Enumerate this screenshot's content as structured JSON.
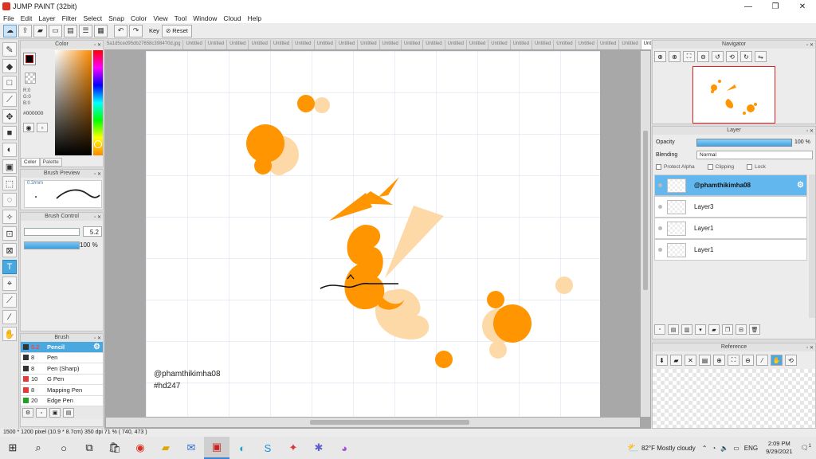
{
  "window": {
    "title": "JUMP PAINT (32bit)",
    "min": "—",
    "max": "❐",
    "close": "✕"
  },
  "menu": [
    "File",
    "Edit",
    "Layer",
    "Filter",
    "Select",
    "Snap",
    "Color",
    "View",
    "Tool",
    "Window",
    "Cloud",
    "Help"
  ],
  "toolbar": {
    "key_label": "Key",
    "reset_label": "Reset"
  },
  "color_panel": {
    "title": "Color",
    "r": "R:0",
    "g": "G:0",
    "b": "B:0",
    "hex": "#000000",
    "tab_color": "Color",
    "tab_palette": "Palette",
    "fg_color": "#000000"
  },
  "brush_preview": {
    "title": "Brush Preview",
    "size": "0.3/mm"
  },
  "brush_control": {
    "title": "Brush Control",
    "size": "5.2",
    "opacity": "100 %",
    "opacity_fraction": 1.0,
    "size_fraction": 0.0
  },
  "brush_list": {
    "title": "Brush",
    "items": [
      {
        "size": "5.2",
        "name": "Pencil",
        "color": "#333333"
      },
      {
        "size": "8",
        "name": "Pen",
        "color": "#333333"
      },
      {
        "size": "8",
        "name": "Pen (Sharp)",
        "color": "#333333"
      },
      {
        "size": "10",
        "name": "G Pen",
        "color": "#e23b3b"
      },
      {
        "size": "8",
        "name": "Mapping Pen",
        "color": "#e23b3b"
      },
      {
        "size": "20",
        "name": "Edge Pen",
        "color": "#21a321"
      }
    ]
  },
  "tabs": [
    "5a1d5ced95db27658c3984?0d.jpg",
    "Untitled",
    "Untitled",
    "Untitled",
    "Untitled",
    "Untitled",
    "Untitled",
    "Untitled",
    "Untitled",
    "Untitled",
    "Untitled",
    "Untitled",
    "Untitled",
    "Untitled",
    "Untitled",
    "Untitled",
    "Untitled",
    "Untitled",
    "Untitled",
    "Untitled",
    "Untitled",
    "Untitled",
    "Untitled"
  ],
  "canvas": {
    "watermark_line1": "@phamthikimha08",
    "watermark_line2": "#hd247",
    "accent_orange": "#ff9500",
    "accent_light": "#fdd9a8"
  },
  "navigator": {
    "title": "Navigator"
  },
  "layer_panel": {
    "title": "Layer",
    "opacity_label": "Opacity",
    "opacity_value": "100 %",
    "blending_label": "Blending",
    "blending_value": "Normal",
    "protect_alpha": "Protect Alpha",
    "clipping": "Clipping",
    "lock": "Lock",
    "layers": [
      "@phamthikimha08",
      "Layer3",
      "Layer1",
      "Layer1"
    ]
  },
  "reference": {
    "title": "Reference"
  },
  "status": {
    "text": "1500 * 1200 pixel   (10.9 * 8.7cm)   350 dpi   71 %   ( 740, 473 )"
  },
  "taskbar": {
    "weather": "82°F  Mostly cloudy",
    "lang": "ENG",
    "time": "2:09 PM",
    "date": "9/29/2021",
    "notif": "1"
  }
}
